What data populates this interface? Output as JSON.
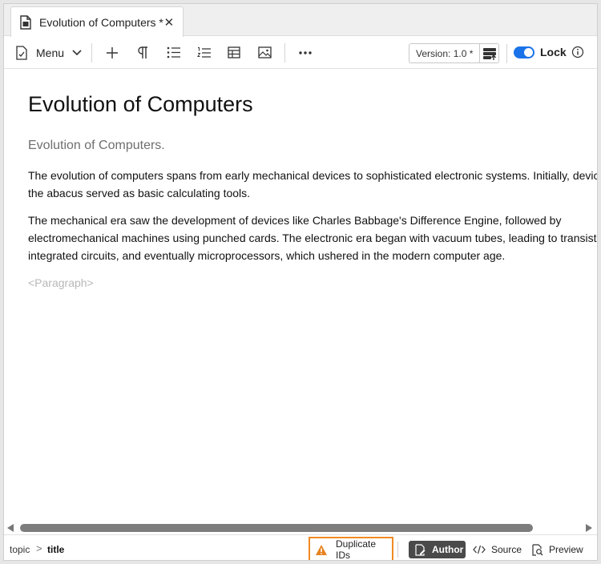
{
  "tab": {
    "title": "Evolution of Computers *",
    "close": "✕"
  },
  "toolbar": {
    "menu_label": "Menu",
    "version_label": "Version: 1.0 *",
    "lock_label": "Lock",
    "icons": [
      "add-icon",
      "paragraph-icon",
      "bullet-list-icon",
      "numbered-list-icon",
      "table-icon",
      "image-icon",
      "more-icon"
    ]
  },
  "document": {
    "title": "Evolution of Computers",
    "shortdesc": "Evolution of Computers.",
    "paragraphs": [
      "The evolution of computers spans from early mechanical devices to sophisticated electronic systems. Initially, devices like the abacus served as basic calculating tools.",
      "The mechanical era saw the development of devices like Charles Babbage's Difference Engine, followed by electromechanical machines using punched cards. The electronic era began with vacuum tubes, leading to transistors, integrated circuits, and eventually microprocessors, which ushered in the modern computer age."
    ],
    "placeholder": "<Paragraph>"
  },
  "statusbar": {
    "breadcrumb": [
      "topic",
      "title"
    ],
    "breadcrumb_separator": ">",
    "duplicate_ids_label": "Duplicate IDs",
    "modes": {
      "author": "Author",
      "source": "Source",
      "preview": "Preview"
    }
  },
  "colors": {
    "accent": "#1a73e8",
    "warning": "#f08a24",
    "active_mode_bg": "#4a4a4a"
  }
}
